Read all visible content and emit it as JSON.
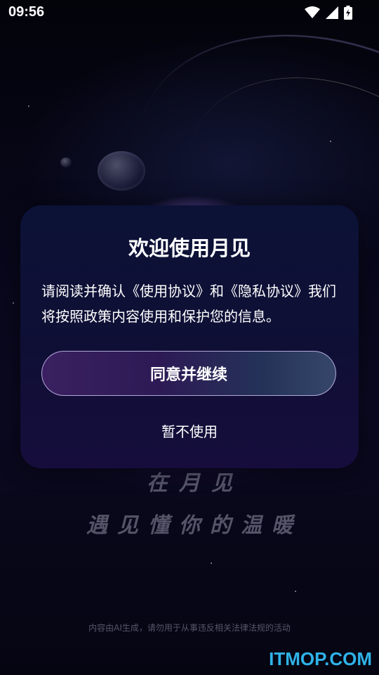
{
  "status_bar": {
    "time": "09:56",
    "icons": [
      "wifi-icon",
      "cellular-signal-icon",
      "battery-charging-icon"
    ]
  },
  "dialog": {
    "title": "欢迎使用月见",
    "body_prefix": "请阅读并确认",
    "terms_link": "《使用协议》",
    "body_middle": "和",
    "privacy_link": "《隐私协议》",
    "body_suffix": "我们将按照政策内容使用和保护您的信息。",
    "agree_label": "同意并继续",
    "decline_label": "暂不使用"
  },
  "background": {
    "slogan_line1": "在月见",
    "slogan_line2": "遇见懂你的温暖",
    "disclaimer": "内容由AI生成，请勿用于从事违反相关法律法规的活动"
  },
  "watermark": "ITMOP.COM",
  "colors": {
    "dialog_bg": "#0f0f36",
    "watermark": "#2fb3e8",
    "button_border": "#c8bef0"
  }
}
